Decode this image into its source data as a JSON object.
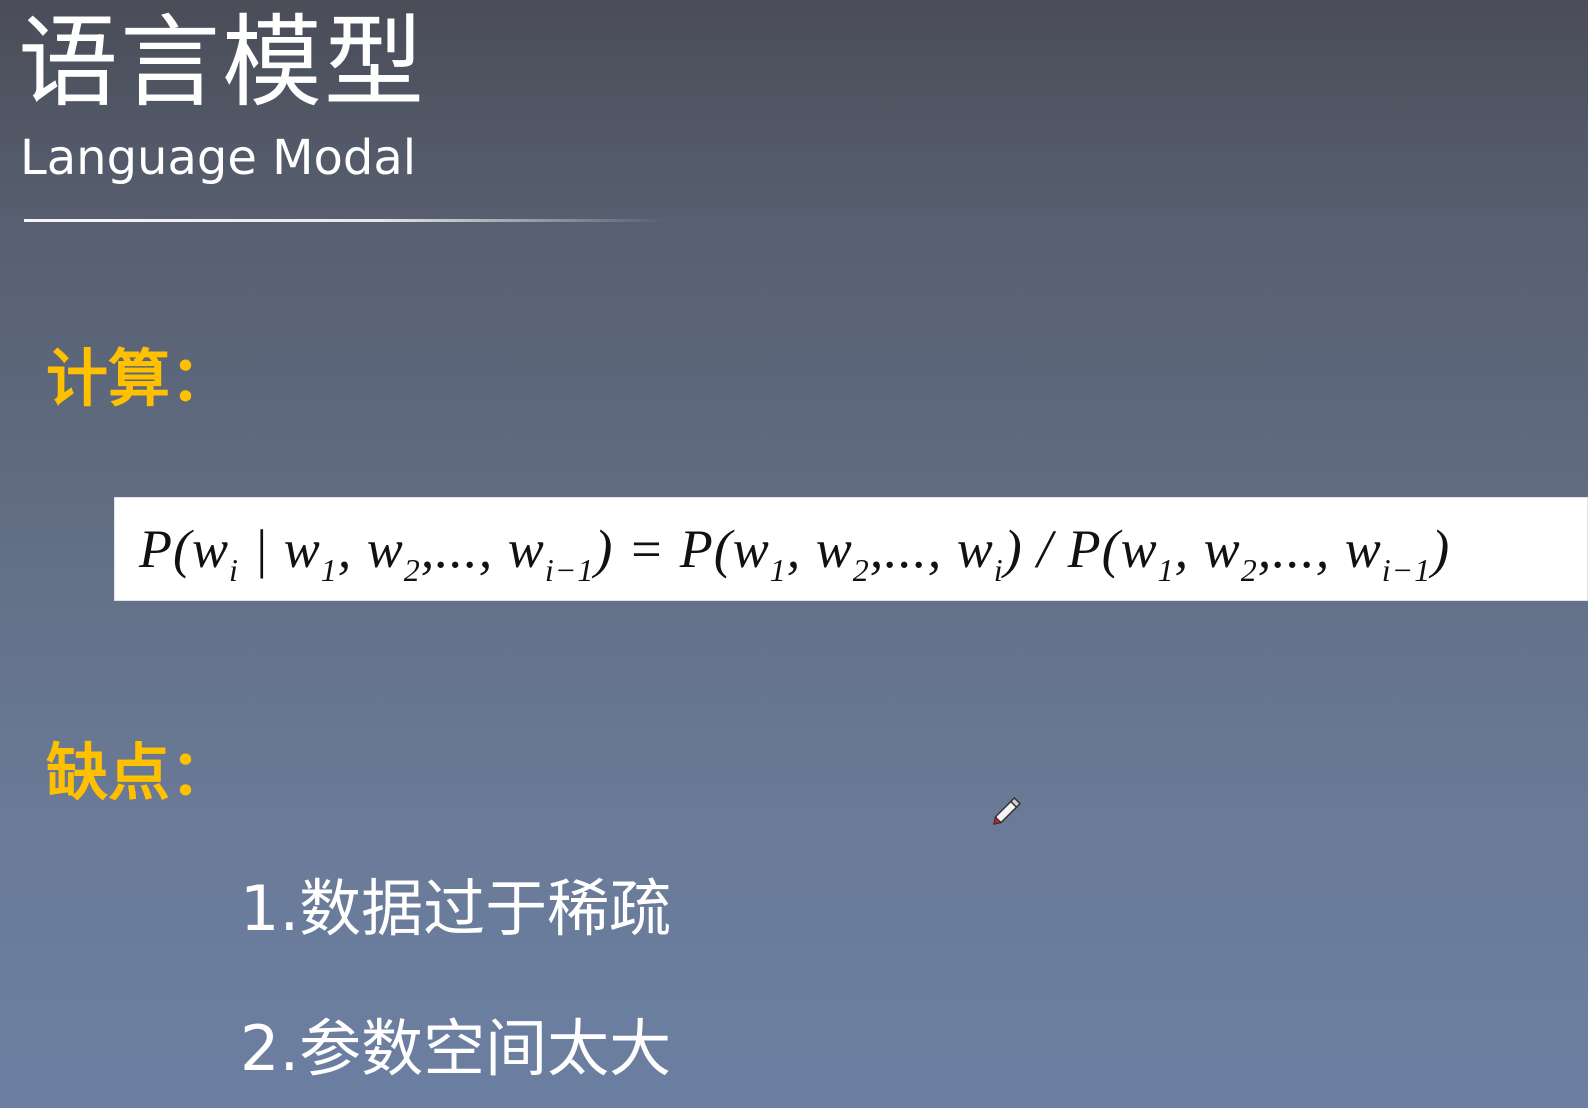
{
  "slide": {
    "title": "语言模型",
    "subtitle": "Language Modal",
    "compute_label": "计算：",
    "formula": {
      "lhs": "P(w",
      "lhs_sub": "i",
      "cond": " | w",
      "s1": "1",
      "c2": ", w",
      "s2": "2",
      "c3": ",..., w",
      "s3": "i−1",
      "eq": ") = P(w",
      "r_s1": "1",
      "r_c2": ", w",
      "r_s2": "2",
      "r_c3": ",..., w",
      "r_s3": "i",
      "div": ") / P(w",
      "d_s1": "1",
      "d_c2": ", w",
      "d_s2": "2",
      "d_c3": ",..., w",
      "d_s3": "i−1",
      "end": ")"
    },
    "cons_label": "缺点：",
    "cons": [
      "1.数据过于稀疏",
      "2.参数空间太大"
    ]
  },
  "colors": {
    "accent": "#ffc000",
    "text": "#ffffff",
    "formula_bg": "#ffffff"
  },
  "icons": {
    "cursor": "pen-cursor-icon"
  }
}
